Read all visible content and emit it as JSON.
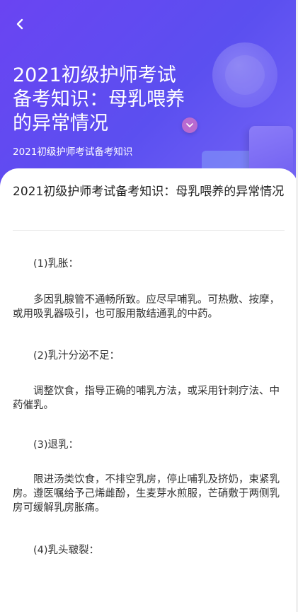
{
  "header": {
    "title": "2021初级护师考试备考知识：母乳喂养的异常情况",
    "subtitle": "2021初级护师考试备考知识"
  },
  "article": {
    "title": "2021初级护师考试备考知识：母乳喂养的异常情况",
    "paragraphs": [
      "(1)乳胀：",
      "多因乳腺管不通畅所致。应尽早哺乳。可热敷、按摩，或用吸乳器吸引，也可服用散结通乳的中药。",
      "(2)乳汁分泌不足：",
      "调整饮食，指导正确的哺乳方法，或采用针刺疗法、中药催乳。",
      "(3)退乳：",
      "限进汤类饮食，不排空乳房，停止哺乳及挤奶，束紧乳房。遵医嘱给予己烯雌酚，生麦芽水煎服，芒硝敷于两侧乳房可缓解乳房胀痛。",
      "(4)乳头皲裂："
    ]
  },
  "colors": {
    "header_start": "#6a44f2",
    "header_end": "#7566f6",
    "text": "#333333"
  },
  "icons": {
    "back": "chevron-left-icon",
    "bubble": "chevron-down-icon"
  }
}
